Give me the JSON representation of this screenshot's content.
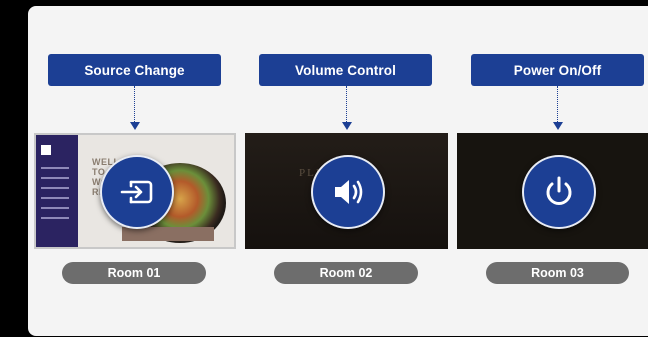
{
  "panels": [
    {
      "action_label": "Source Change",
      "room_label": "Room 01",
      "icon": "input-source-icon",
      "screen_text": "WELLCOME TO WORKING RESTAURANT"
    },
    {
      "action_label": "Volume Control",
      "room_label": "Room 02",
      "icon": "speaker-volume-icon",
      "screen_text": "PLE TEL"
    },
    {
      "action_label": "Power On/Off",
      "room_label": "Room 03",
      "icon": "power-icon"
    }
  ],
  "colors": {
    "accent": "#1c3f94",
    "pill": "#6d6d6d",
    "card_bg": "#f4f4f4",
    "page_bg": "#000000"
  }
}
